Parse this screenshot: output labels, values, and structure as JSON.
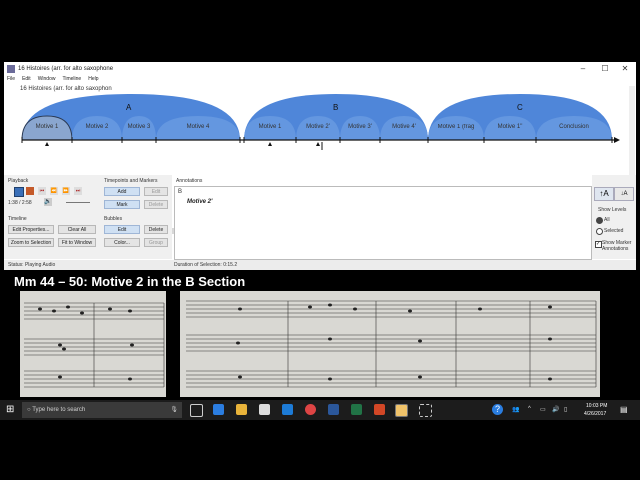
{
  "window": {
    "title": "16 Histoires (arr. for alto saxophone",
    "doc_title": "16 Histoires (arr. for alto saxophon",
    "menu": [
      "File",
      "Edit",
      "Window",
      "Timeline",
      "Help"
    ]
  },
  "sections": [
    {
      "label": "A"
    },
    {
      "label": "B"
    },
    {
      "label": "C"
    }
  ],
  "bubbles": [
    "Motive 1",
    "Motive 2",
    "Motive 3",
    "Motive 4",
    "Motive 1",
    "Motive 2'",
    "Motive 3'",
    "Motive 4'",
    "Motive 1 (frag",
    "Motive 1\"",
    "Conclusion"
  ],
  "playback": {
    "heading": "Playback",
    "time": "1:38 / 2:58"
  },
  "timepoints": {
    "heading": "Timepoints and Markers",
    "add": "Add",
    "edit": "Edit",
    "mark": "Mark",
    "delete": "Delete"
  },
  "timeline_group": {
    "heading": "Timeline",
    "edit_properties": "Edit Properties...",
    "clear_all": "Clear All",
    "zoom_to_selection": "Zoom to Selection",
    "fit_to_window": "Fit to Window"
  },
  "bubbles_group": {
    "heading": "Bubbles",
    "edit": "Edit",
    "delete": "Delete",
    "color": "Color...",
    "group": "Group"
  },
  "annotations": {
    "heading": "Annotations",
    "section": "B",
    "text": "Motive 2'"
  },
  "levels": {
    "show_levels": "Show Levels",
    "all": "All",
    "selected": "Selected",
    "show_marker": "Show Marker Annotations"
  },
  "status": {
    "left": "Status: Playing Audio",
    "right": "Duration of Selection: 0:15.2"
  },
  "score": {
    "heading": "Mm 44 – 50: Motive 2 in the B Section"
  },
  "taskbar": {
    "search": "Type here to search",
    "time": "10:03 PM",
    "date": "4/26/2017"
  },
  "colors": {
    "section_fill": "#4f86d9",
    "bubble_fill": "#6497e0",
    "selected_bubble": "#8aa6cf"
  }
}
